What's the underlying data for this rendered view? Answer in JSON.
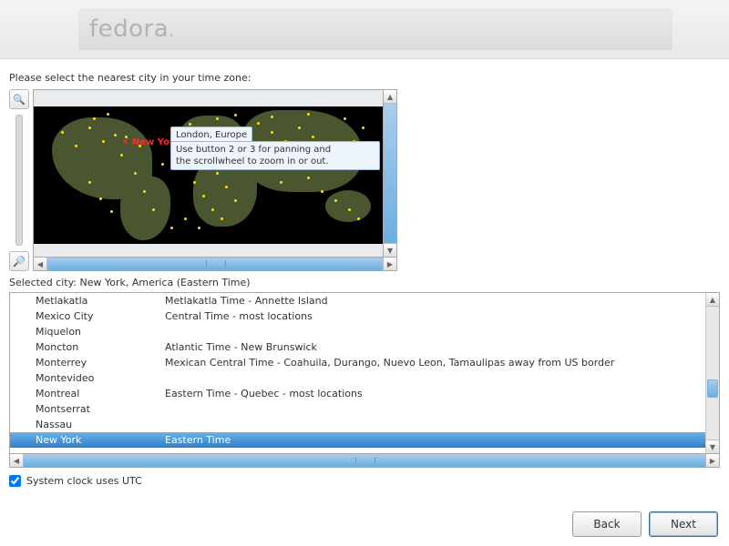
{
  "banner": {
    "logo": "fedora"
  },
  "instruction": "Please select the nearest city in your time zone:",
  "map": {
    "hover_label": "London, Europe",
    "tooltip_line1": "Use button 2 or 3 for panning and",
    "tooltip_line2": "the scrollwheel to zoom in or out.",
    "pin_label": "New York"
  },
  "zoom": {
    "in_icon": "magnify-plus-icon",
    "out_icon": "magnify-minus-icon"
  },
  "selected_label": "Selected city:",
  "selected_value": "New York, America (Eastern Time)",
  "cities": [
    {
      "name": "Metlakatla",
      "desc": "Metlakatla Time - Annette Island"
    },
    {
      "name": "Mexico City",
      "desc": "Central Time - most locations"
    },
    {
      "name": "Miquelon",
      "desc": ""
    },
    {
      "name": "Moncton",
      "desc": "Atlantic Time - New Brunswick"
    },
    {
      "name": "Monterrey",
      "desc": "Mexican Central Time - Coahuila, Durango, Nuevo Leon, Tamaulipas away from US border"
    },
    {
      "name": "Montevideo",
      "desc": ""
    },
    {
      "name": "Montreal",
      "desc": "Eastern Time - Quebec - most locations"
    },
    {
      "name": "Montserrat",
      "desc": ""
    },
    {
      "name": "Nassau",
      "desc": ""
    },
    {
      "name": "New York",
      "desc": "Eastern Time",
      "selected": true
    }
  ],
  "utc": {
    "label": "System clock uses UTC",
    "checked": true
  },
  "buttons": {
    "back": "Back",
    "next": "Next"
  }
}
